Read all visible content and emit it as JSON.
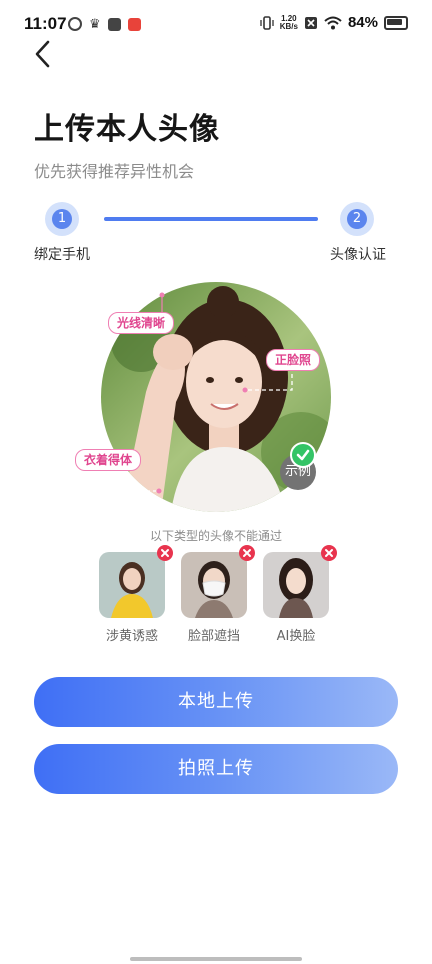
{
  "status_bar": {
    "time": "11:07",
    "speed_value": "1.20",
    "speed_unit": "KB/s",
    "battery": "84%"
  },
  "header": {
    "title": "上传本人头像",
    "subtitle": "优先获得推荐异性机会"
  },
  "steps": [
    {
      "number": "1",
      "label": "绑定手机"
    },
    {
      "number": "2",
      "label": "头像认证"
    }
  ],
  "example": {
    "tags": {
      "light": "光线清晰",
      "face": "正脸照",
      "dress": "衣着得体"
    },
    "badge": "示例"
  },
  "rejections": {
    "caption": "以下类型的头像不能通过",
    "items": [
      {
        "label": "涉黄诱惑"
      },
      {
        "label": "脸部遮挡"
      },
      {
        "label": "AI换脸"
      }
    ]
  },
  "buttons": {
    "local_upload": "本地上传",
    "take_photo": "拍照上传"
  },
  "colors": {
    "accent": "#4f7cf0",
    "tag_pink": "#e0468f",
    "reject_red": "#e8344e",
    "ok_green": "#34c466"
  }
}
